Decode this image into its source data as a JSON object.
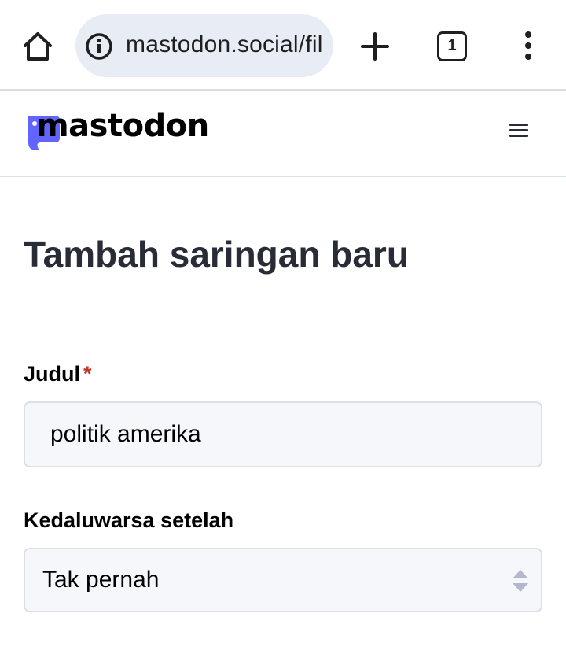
{
  "browser": {
    "url": "mastodon.social/fil",
    "tab_count": "1",
    "icons": [
      "home-icon",
      "info-icon",
      "plus-icon",
      "tab-switcher-icon",
      "more-vert-icon"
    ]
  },
  "site": {
    "logo_text": "mastodon",
    "brand_color": "#6364ff",
    "menu_icon": "hamburger-icon"
  },
  "main": {
    "title": "Tambah saringan baru",
    "fields": {
      "title_label": "Judul",
      "title_required": "*",
      "title_value": "politik amerika",
      "expires_label": "Kedaluwarsa setelah",
      "expires_value": "Tak pernah"
    }
  }
}
